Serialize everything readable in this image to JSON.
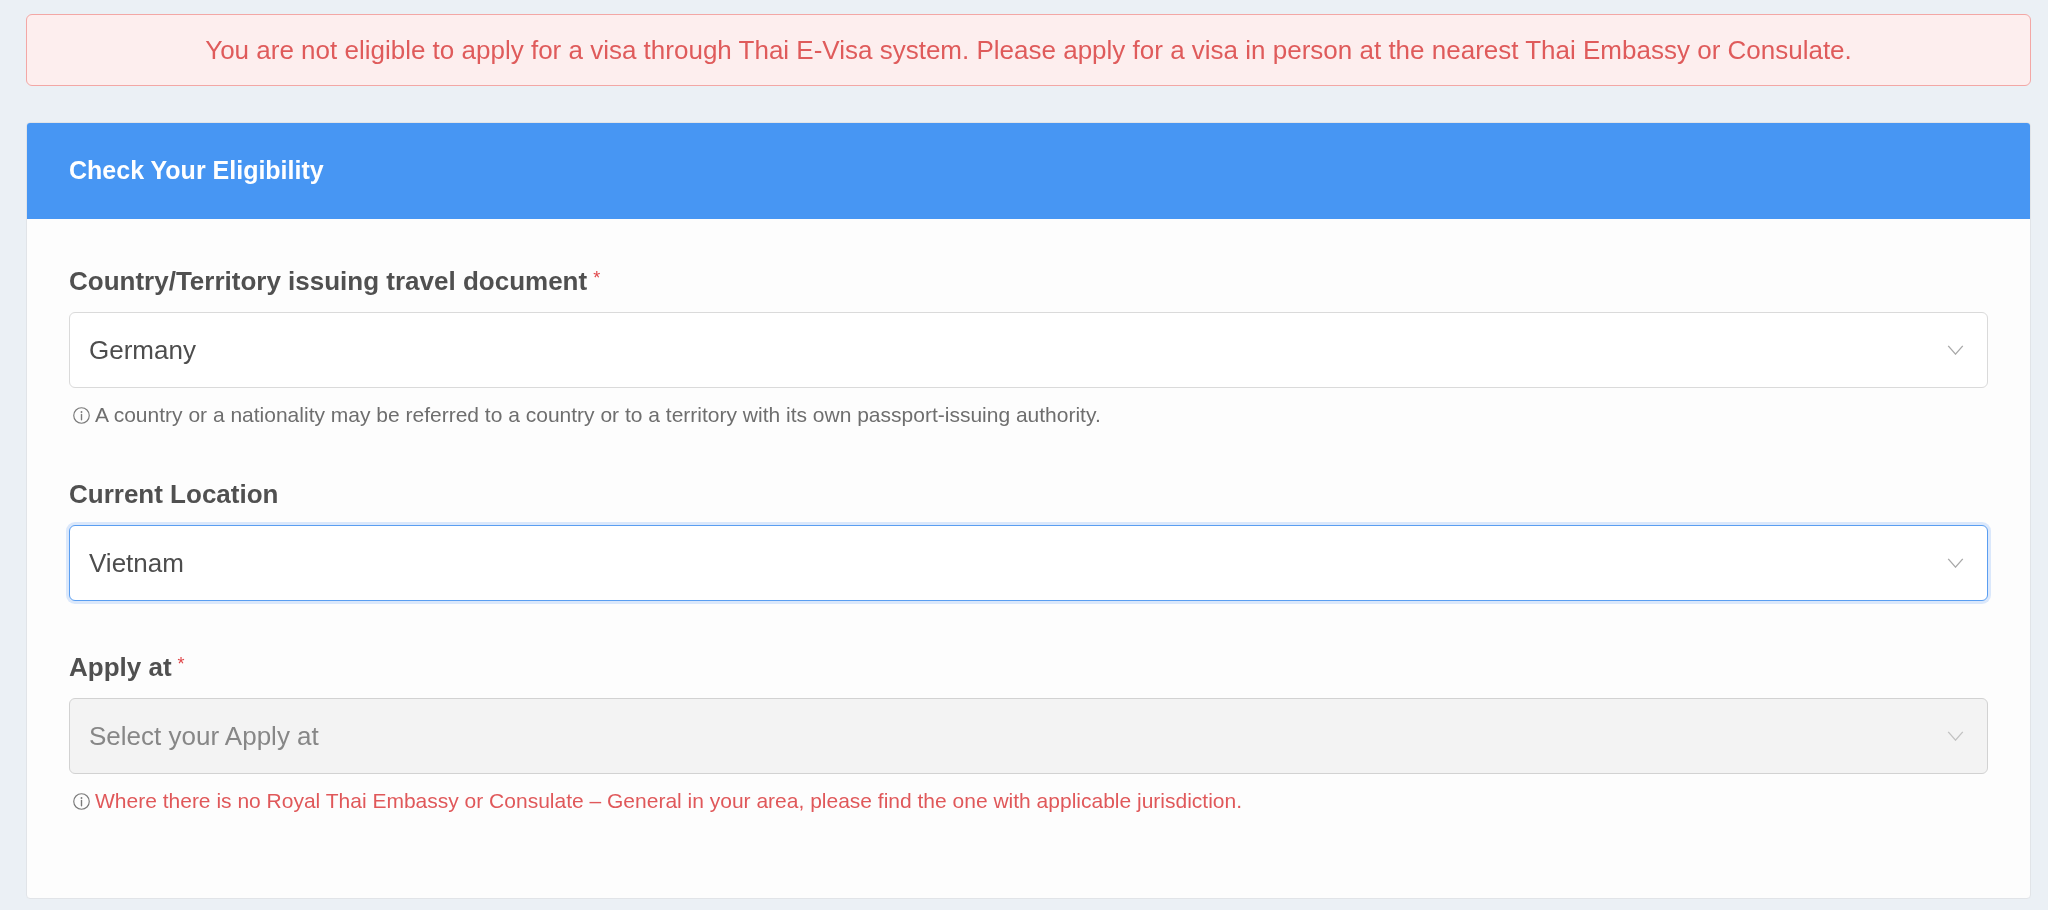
{
  "alert": {
    "text": "You are not eligible to apply for a visa through Thai E-Visa system. Please apply for a visa in person at the nearest Thai Embassy or Consulate."
  },
  "card": {
    "title": "Check Your Eligibility",
    "fields": [
      {
        "label": "Country/Territory issuing travel document",
        "required_mark": "*",
        "value": "Germany",
        "focused": false,
        "disabled": false,
        "hint": {
          "text": "A country or a nationality may be referred to a country or to a territory with its own passport-issuing authority.",
          "kind": "note"
        }
      },
      {
        "label": "Current Location",
        "value": "Vietnam",
        "focused": true,
        "disabled": false
      },
      {
        "label": "Apply at",
        "required_mark": "*",
        "placeholder": "Select your Apply at",
        "focused": false,
        "disabled": true,
        "hint": {
          "text": "Where there is no Royal Thai Embassy or Consulate – General in your area, please find the one with applicable jurisdiction.",
          "kind": "error"
        }
      }
    ]
  }
}
